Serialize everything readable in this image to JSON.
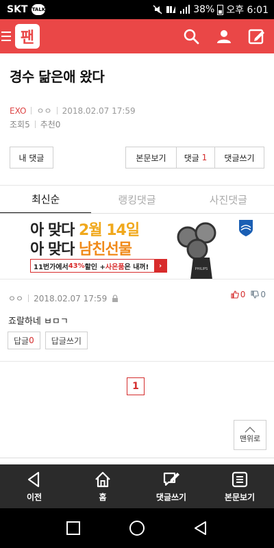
{
  "status": {
    "carrier": "SKT",
    "talk_badge": "TALK",
    "battery": "38%",
    "time": "오후 6:01",
    "icons": [
      "mute-icon",
      "signal-icon",
      "battery-icon"
    ]
  },
  "appbar": {
    "logo_text": "팬",
    "icons": [
      "menu-icon",
      "search-icon",
      "user-icon",
      "write-icon"
    ],
    "bg_color": "#ea4747"
  },
  "post": {
    "title": "경수 닮은애 왔다",
    "category": "EXO",
    "author": "ㅇㅇ",
    "date": "2018.02.07 17:59",
    "views_label": "조회5",
    "recommend_label": "추천0"
  },
  "actions": {
    "my_comments": "내 댓글",
    "view_post": "본문보기",
    "comments_label": "댓글",
    "comments_count": "1",
    "write_comment": "댓글쓰기"
  },
  "tabs": [
    {
      "label": "최신순",
      "active": true
    },
    {
      "label": "랭킹댓글",
      "active": false
    },
    {
      "label": "사진댓글",
      "active": false
    }
  ],
  "ad": {
    "line1_a": "아 맞다 ",
    "line1_b": "2월 14일",
    "line2_a": "아 맞다 ",
    "line2_b": "남친선물",
    "strip_a": "11번가에서 ",
    "strip_b": "43%",
    "strip_c": "할인 + ",
    "strip_d": "사은품",
    "strip_e": "은 내꺼!",
    "strip_arrow": "›",
    "brand": "PHILIPS"
  },
  "comment": {
    "author": "ㅇㅇ",
    "date": "2018.02.07 17:59",
    "up_count": "0",
    "down_count": "0",
    "text": "죠랄하네 ㅂㅁㄱ",
    "reply_label": "답글",
    "reply_count": "0",
    "write_reply": "답글쓰기"
  },
  "pagination": {
    "current": "1"
  },
  "to_top": "맨위로",
  "bottombar": [
    {
      "label": "이전",
      "icon": "back-arrow-icon"
    },
    {
      "label": "홈",
      "icon": "home-icon"
    },
    {
      "label": "댓글쓰기",
      "icon": "comment-write-icon"
    },
    {
      "label": "본문보기",
      "icon": "document-icon"
    }
  ],
  "navbar": [
    "recent-apps-icon",
    "home-circle-icon",
    "back-triangle-icon"
  ]
}
